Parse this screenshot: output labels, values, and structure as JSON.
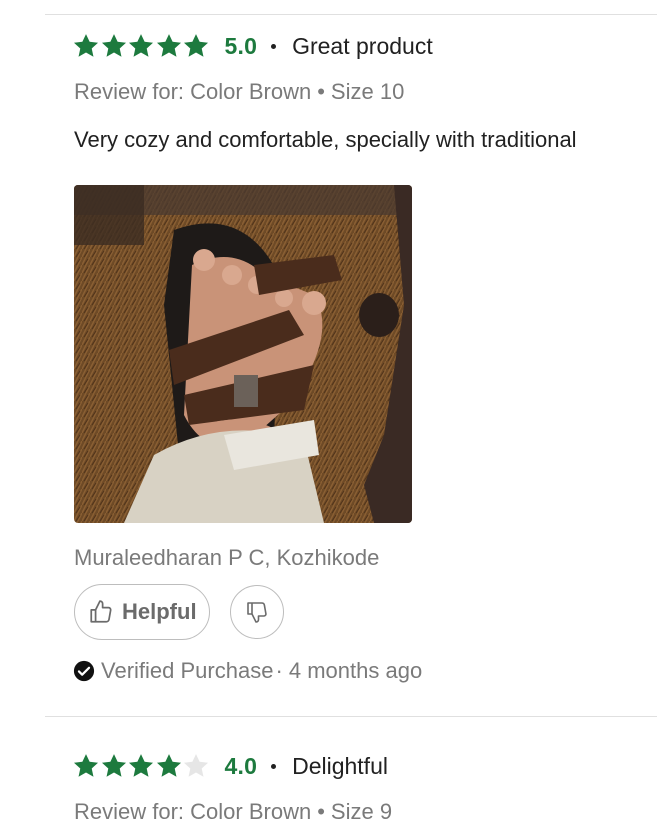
{
  "reviews": [
    {
      "rating_value": 5,
      "score": "5.0",
      "headline": "Great product",
      "review_for_prefix": "Review for:",
      "color": "Color Brown",
      "bullet": "•",
      "size": "Size 10",
      "body": "Very cozy and comfortable, specially with traditional",
      "photo_icon": "review-photo",
      "author": "Muraleedharan P C, Kozhikode",
      "helpful_label": "Helpful",
      "verified_label": "Verified Purchase",
      "time_ago": "· 4 months ago"
    },
    {
      "rating_value": 4,
      "score": "4.0",
      "headline": "Delightful",
      "review_for_prefix": "Review for:",
      "color": "Color Brown",
      "bullet": "•",
      "size": "Size 9"
    }
  ],
  "colors": {
    "star_filled": "#1d7a3e",
    "star_empty": "#e6e6e6",
    "score_green": "#1d7a3e",
    "muted_text": "#7a7a7a"
  },
  "icons": {
    "helpful": "thumbs-up-icon",
    "unhelpful": "thumbs-down-icon",
    "verified": "check-circle-icon",
    "rating": "star-icon"
  }
}
